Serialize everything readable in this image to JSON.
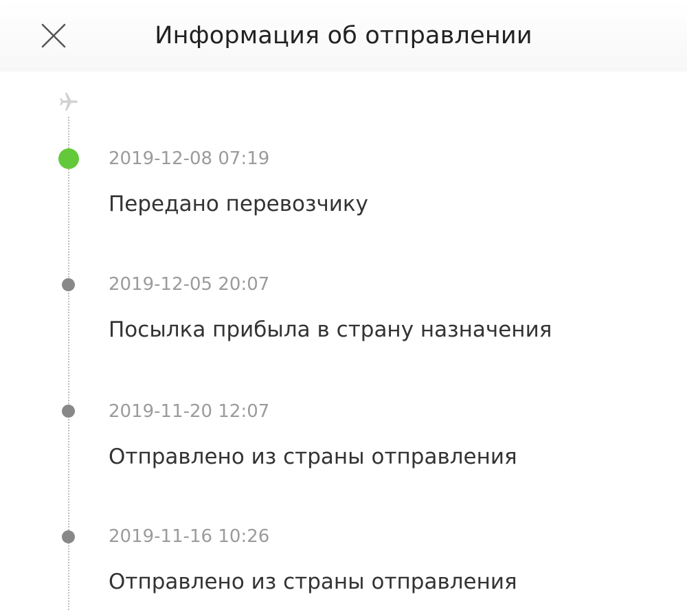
{
  "header": {
    "title": "Информация об отправлении"
  },
  "timeline": {
    "events": [
      {
        "date": "2019-12-08 07:19",
        "status": "Передано перевозчику",
        "current": true
      },
      {
        "date": "2019-12-05 20:07",
        "status": "Посылка прибыла в страну назначения",
        "current": false
      },
      {
        "date": "2019-11-20 12:07",
        "status": "Отправлено из страны отправления",
        "current": false
      },
      {
        "date": "2019-11-16 10:26",
        "status": "Отправлено из страны отправления",
        "current": false
      }
    ]
  },
  "colors": {
    "current_dot": "#63c93a",
    "past_dot": "#888888",
    "date_text": "#9b9b9b",
    "status_text": "#333333"
  },
  "icons": {
    "close": "close-icon",
    "plane": "plane-icon"
  }
}
